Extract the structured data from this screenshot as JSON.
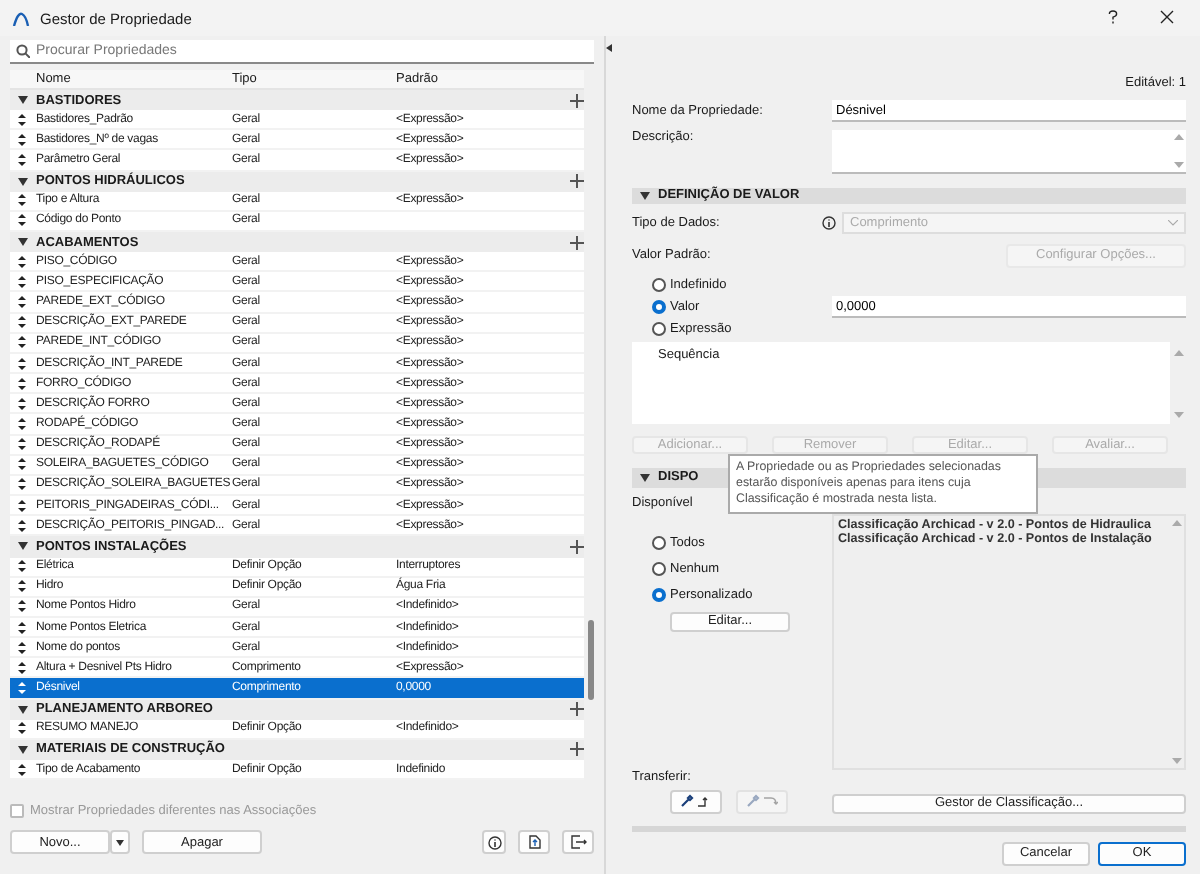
{
  "window": {
    "title": "Gestor de Propriedade"
  },
  "search": {
    "placeholder": "Procurar Propriedades"
  },
  "table": {
    "columns": [
      "Nome",
      "Tipo",
      "Padrão"
    ],
    "groups": [
      {
        "name": "BASTIDORES",
        "expanded": true,
        "rows": [
          {
            "name": "Bastidores_Padrão",
            "type": "Geral",
            "default": "<Expressão>",
            "selected": false
          },
          {
            "name": "Bastidores_Nº de vagas",
            "type": "Geral",
            "default": "<Expressão>",
            "selected": false
          },
          {
            "name": "Parâmetro Geral",
            "type": "Geral",
            "default": "<Expressão>",
            "selected": false
          }
        ]
      },
      {
        "name": "PONTOS HIDRÁULICOS",
        "expanded": true,
        "rows": [
          {
            "name": "Tipo e Altura",
            "type": "Geral",
            "default": "<Expressão>",
            "selected": false
          },
          {
            "name": "Código do Ponto",
            "type": "Geral",
            "selected": false
          }
        ]
      },
      {
        "name": "ACABAMENTOS",
        "expanded": true,
        "rows": [
          {
            "name": "PISO_CÓDIGO",
            "type": "Geral",
            "default": "<Expressão>",
            "selected": false
          },
          {
            "name": "PISO_ESPECIFICAÇÃO",
            "type": "Geral",
            "default": "<Expressão>",
            "selected": false
          },
          {
            "name": "PAREDE_EXT_CÓDIGO",
            "type": "Geral",
            "default": "<Expressão>",
            "selected": false
          },
          {
            "name": "DESCRIÇÃO_EXT_PAREDE",
            "type": "Geral",
            "default": "<Expressão>",
            "selected": false
          },
          {
            "name": "PAREDE_INT_CÓDIGO",
            "type": "Geral",
            "default": "<Expressão>",
            "selected": false
          },
          {
            "name": "DESCRIÇÃO_INT_PAREDE",
            "type": "Geral",
            "default": "<Expressão>",
            "selected": false
          },
          {
            "name": "FORRO_CÓDIGO",
            "type": "Geral",
            "default": "<Expressão>",
            "selected": false
          },
          {
            "name": "DESCRIÇÃO FORRO",
            "type": "Geral",
            "default": "<Expressão>",
            "selected": false
          },
          {
            "name": "RODAPÉ_CÓDIGO",
            "type": "Geral",
            "default": "<Expressão>",
            "selected": false
          },
          {
            "name": "DESCRIÇÃO_RODAPÉ",
            "type": "Geral",
            "default": "<Expressão>",
            "selected": false
          },
          {
            "name": "SOLEIRA_BAGUETES_CÓDIGO",
            "type": "Geral",
            "default": "<Expressão>",
            "selected": false
          },
          {
            "name": "DESCRIÇÃO_SOLEIRA_BAGUETES",
            "type": "Geral",
            "default": "<Expressão>",
            "selected": false
          },
          {
            "name": "PEITORIS_PINGADEIRAS_CÓDI...",
            "type": "Geral",
            "default": "<Expressão>",
            "selected": false
          },
          {
            "name": "DESCRIÇÃO_PEITORIS_PINGAD...",
            "type": "Geral",
            "default": "<Expressão>",
            "selected": false
          }
        ]
      },
      {
        "name": "PONTOS INSTALAÇÕES",
        "expanded": true,
        "rows": [
          {
            "name": "Elétrica",
            "type": "Definir Opção",
            "default": "Interruptores",
            "selected": false
          },
          {
            "name": "Hidro",
            "type": "Definir Opção",
            "default": "Água Fria",
            "selected": false
          },
          {
            "name": "Nome Pontos Hidro",
            "type": "Geral",
            "default": "<Indefinido>",
            "selected": false
          },
          {
            "name": "Nome Pontos Eletrica",
            "type": "Geral",
            "default": "<Indefinido>",
            "selected": false
          },
          {
            "name": "Nome do pontos",
            "type": "Geral",
            "default": "<Indefinido>",
            "selected": false
          },
          {
            "name": "Altura + Desnivel Pts Hidro",
            "type": "Comprimento",
            "default": "<Expressão>",
            "selected": false
          },
          {
            "name": "Désnivel",
            "type": "Comprimento",
            "default": "0,0000",
            "selected": true
          }
        ]
      },
      {
        "name": "PLANEJAMENTO ARBOREO",
        "expanded": true,
        "rows": [
          {
            "name": "RESUMO MANEJO",
            "type": "Definir Opção",
            "default": "<Indefinido>",
            "selected": false
          }
        ]
      },
      {
        "name": "MATERIAIS DE CONSTRUÇÃO",
        "expanded": true,
        "rows": [
          {
            "name": "Tipo de Acabamento",
            "type": "Definir Opção",
            "default": "Indefinido",
            "selected": false
          }
        ]
      }
    ]
  },
  "show_different": {
    "label": "Mostrar Propriedades diferentes nas Associações",
    "checked": false,
    "disabled": true
  },
  "left_buttons": {
    "new": "Novo...",
    "delete": "Apagar"
  },
  "editable": "Editável: 1",
  "property_name": {
    "label": "Nome da Propriedade:",
    "value": "Désnivel"
  },
  "description": {
    "label": "Descrição:"
  },
  "value_section": {
    "title": "DEFINIÇÃO DE VALOR",
    "expanded": true
  },
  "data_type": {
    "label": "Tipo de Dados:",
    "value": "Comprimento",
    "disabled": true
  },
  "default_value": {
    "label": "Valor Padrão:",
    "configure": "Configurar Opções...",
    "options": [
      {
        "label": "Indefinido",
        "selected": false
      },
      {
        "label": "Valor",
        "selected": true
      },
      {
        "label": "Expressão",
        "selected": false
      }
    ],
    "value": "0,0000"
  },
  "sequence": {
    "header": "Sequência"
  },
  "sequence_buttons": [
    {
      "label": "Adicionar...",
      "disabled": true
    },
    {
      "label": "Remover",
      "disabled": true
    },
    {
      "label": "Editar...",
      "disabled": true
    },
    {
      "label": "Avaliar...",
      "disabled": true
    }
  ],
  "class_section": {
    "title": "DISPO",
    "expanded": true
  },
  "available_label": "Disponível",
  "tooltip": "A Propriedade ou as Propriedades selecionadas estarão disponíveis apenas para itens cuja Classificação é mostrada nesta lista.",
  "availability": [
    {
      "label": "Todos",
      "selected": false
    },
    {
      "label": "Nenhum",
      "selected": false
    },
    {
      "label": "Personalizado",
      "selected": true
    }
  ],
  "edit_button": "Editar...",
  "classifications": [
    "Classificação Archicad - v 2.0 - Pontos de Hidraulica",
    "Classificação Archicad - v 2.0 - Pontos de Instalação"
  ],
  "transfer": {
    "label": "Transferir:",
    "buttons": [
      {
        "kind": "pick",
        "disabled": false
      },
      {
        "kind": "inject",
        "disabled": true
      }
    ]
  },
  "classification_manager": "Gestor de Classificação...",
  "dialog_buttons": {
    "cancel": "Cancelar",
    "ok": "OK"
  }
}
